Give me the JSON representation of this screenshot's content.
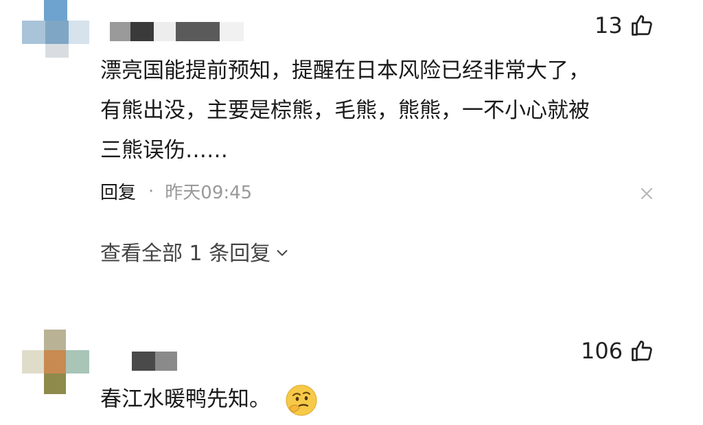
{
  "comments": [
    {
      "likes": "13",
      "text_lines": [
        "漂亮国能提前预知，提醒在日本风险已经非常大了，",
        "有熊出没，主要是棕熊，毛熊，熊熊，一不小心就被",
        "三熊误伤……"
      ],
      "reply_label": "回复",
      "separator": "·",
      "time": "昨天09:45",
      "expand_label": "查看全部 1 条回复"
    },
    {
      "likes": "106",
      "text": "春江水暖鸭先知。",
      "emoji": "thinking-face"
    }
  ],
  "colors": {
    "muted": "#999999",
    "text": "#1a1a1a"
  }
}
